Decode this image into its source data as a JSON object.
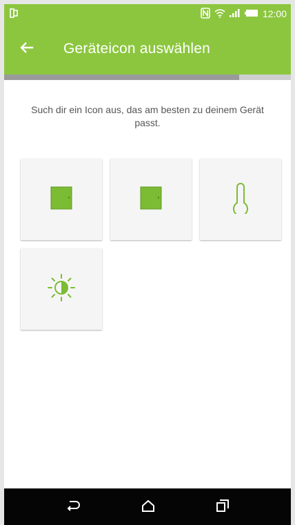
{
  "status_bar": {
    "time": "12:00",
    "icons": [
      "device-frame-icon",
      "nfc-icon",
      "wifi-icon",
      "signal-icon",
      "battery-icon"
    ]
  },
  "app_bar": {
    "back_icon": "arrow-back-icon",
    "title": "Geräteicon auswählen"
  },
  "progress": {
    "value": 0.82
  },
  "main": {
    "hint_text": "Such dir ein Icon aus, das am besten zu deinem Gerät passt."
  },
  "icon_options": [
    "door-icon",
    "door-icon",
    "thermometer-icon",
    "brightness-icon"
  ],
  "colors": {
    "accent": "#8cc63f",
    "icon_green": "#7cbb34",
    "nav_bar": "#050505"
  },
  "nav_bar": {
    "buttons": [
      "back-icon",
      "home-icon",
      "recents-icon"
    ]
  }
}
